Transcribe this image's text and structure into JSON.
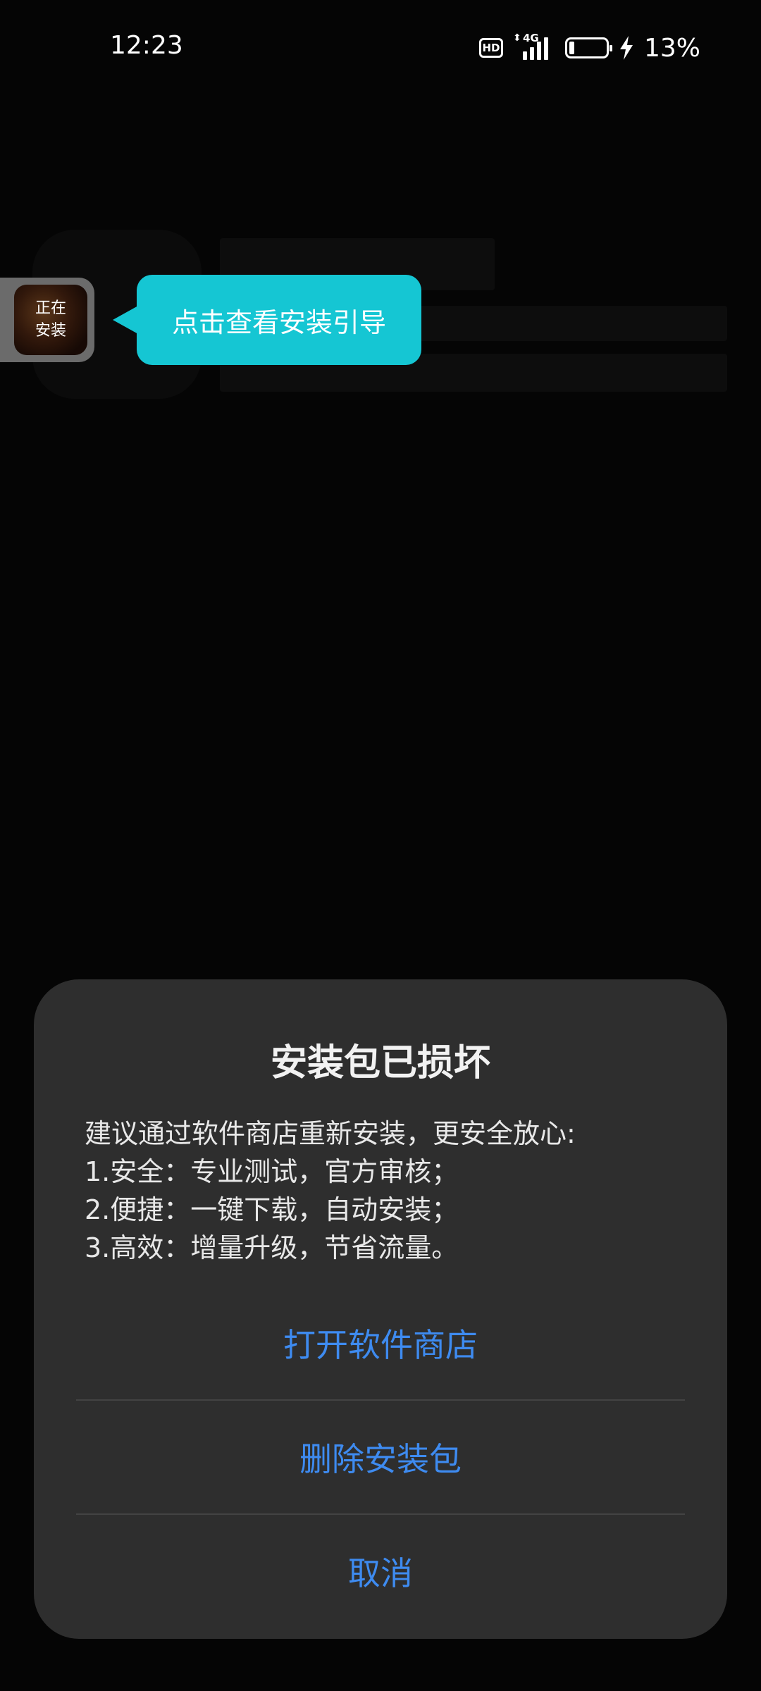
{
  "status_bar": {
    "time": "12:23",
    "hd_badge": "HD",
    "network": "4G",
    "battery_percent_text": "13%",
    "battery_level": 0.13
  },
  "floating_widget": {
    "label_line1": "正在",
    "label_line2": "安装"
  },
  "tooltip": {
    "text": "点击查看安装引导",
    "color": "#15c6d3"
  },
  "dialog": {
    "title": "安装包已损坏",
    "body": [
      "建议通过软件商店重新安装，更安全放心:",
      "1.安全：专业测试，官方审核；",
      "2.便捷：一键下载，自动安装；",
      "3.高效：增量升级，节省流量。"
    ],
    "actions": {
      "open_store": "打开软件商店",
      "delete_package": "删除安装包",
      "cancel": "取消"
    },
    "accent_color": "#3e8bf0"
  }
}
